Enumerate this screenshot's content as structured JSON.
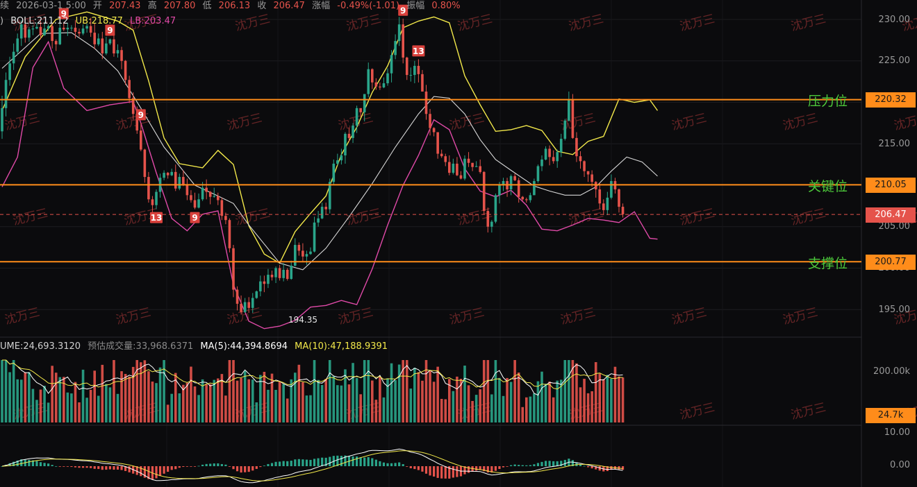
{
  "header": {
    "prefix": "续",
    "datetime": "2026-03-1",
    "datetime_suffix": "5:00",
    "open_label": "开",
    "open": "207.43",
    "high_label": "高",
    "high": "207.80",
    "low_label": "低",
    "low": "206.13",
    "close_label": "收",
    "close": "206.47",
    "change_label": "涨幅",
    "change": "-0.49%(-1.01)",
    "amp_label": "振幅",
    "amp": "0.80%"
  },
  "boll": {
    "paren": ")",
    "mid": "BOLL:211.12",
    "ub": "UB:218.77",
    "lb": "LB:203.47"
  },
  "volume": {
    "volume": "UME:24,693.3120",
    "est": "预估成交量:33,968.6371",
    "ma5": "MA(5):44,394.8694",
    "ma10": "MA(10):47,188.9391"
  },
  "levels": [
    {
      "name": "压力位",
      "value": "220.32",
      "price": 220.32
    },
    {
      "name": "关键位",
      "value": "210.05",
      "price": 210.05
    },
    {
      "name": "支撑位",
      "value": "200.77",
      "price": 200.77
    }
  ],
  "current_price": {
    "value": "206.47",
    "price": 206.47
  },
  "price_ticks": [
    "230.00",
    "225.00",
    "215.00",
    "205.00",
    "200.00",
    "195.00"
  ],
  "volume_ticks": [
    "200.00k"
  ],
  "volume_current": "24.7k",
  "macd_ticks": [
    "10.00",
    "0.00"
  ],
  "low_mark": "194.35",
  "watermark": "沈万三",
  "markers": [
    {
      "text": "9",
      "i": 16,
      "pos": "above"
    },
    {
      "text": "9",
      "i": 28,
      "pos": "above"
    },
    {
      "text": "9",
      "i": 36,
      "pos": "above"
    },
    {
      "text": "13",
      "i": 40,
      "pos": "below"
    },
    {
      "text": "9",
      "i": 50,
      "pos": "below"
    },
    {
      "text": "9",
      "i": 104,
      "pos": "above"
    },
    {
      "text": "13",
      "i": 108,
      "pos": "above"
    }
  ],
  "colors": {
    "up": "#e5534b",
    "down": "#2aa58a",
    "level": "#ff8c1a",
    "level_label": "#4cc83a",
    "mid": "#d8d8d8",
    "ub": "#f2e84a",
    "lb": "#e04aa8",
    "watermark": "#b03a3a"
  },
  "chart_data": {
    "type": "candlestick",
    "title": "",
    "yaxis_range": [
      191.5,
      231.5
    ],
    "candles": [
      [
        216.5,
        219.3,
        220.8,
        215.6
      ],
      [
        219.3,
        222.7,
        223.6,
        218.3
      ],
      [
        222.7,
        224.7,
        225.5,
        222.0
      ],
      [
        224.7,
        226.1,
        227.1,
        223.9
      ],
      [
        226.1,
        227.7,
        228.3,
        225.7
      ],
      [
        227.7,
        229.4,
        229.9,
        226.8
      ],
      [
        229.4,
        227.8,
        230.1,
        227.2
      ],
      [
        227.8,
        228.8,
        229.1,
        227.3
      ],
      [
        228.8,
        228.9,
        229.3,
        228.1
      ],
      [
        228.9,
        229.1,
        229.6,
        228.8
      ],
      [
        229.1,
        228.1,
        229.8,
        227.6
      ],
      [
        228.1,
        228.9,
        229.7,
        228.0
      ],
      [
        228.9,
        229.2,
        229.4,
        228.6
      ],
      [
        229.2,
        227.4,
        229.6,
        226.5
      ],
      [
        227.4,
        227.0,
        227.6,
        226.2
      ],
      [
        227.0,
        229.0,
        230.1,
        226.9
      ],
      [
        229.0,
        228.8,
        229.7,
        228.6
      ],
      [
        228.8,
        229.0,
        229.6,
        228.0
      ],
      [
        229.0,
        229.0,
        229.3,
        228.6
      ],
      [
        229.0,
        228.5,
        229.9,
        227.7
      ],
      [
        228.5,
        228.3,
        228.9,
        227.9
      ],
      [
        228.3,
        228.9,
        229.4,
        228.1
      ],
      [
        228.9,
        229.2,
        229.5,
        228.4
      ],
      [
        229.2,
        228.4,
        230.2,
        227.9
      ],
      [
        228.4,
        227.0,
        229.5,
        226.4
      ],
      [
        227.0,
        227.7,
        228.3,
        226.8
      ],
      [
        227.7,
        225.9,
        228.5,
        225.2
      ],
      [
        225.9,
        227.1,
        227.9,
        225.7
      ],
      [
        227.1,
        227.6,
        227.7,
        226.9
      ],
      [
        227.6,
        225.9,
        228.4,
        225.5
      ],
      [
        225.9,
        226.3,
        227.0,
        225.4
      ],
      [
        226.3,
        225.0,
        226.7,
        224.0
      ],
      [
        225.0,
        222.7,
        225.1,
        222.1
      ],
      [
        222.7,
        220.5,
        223.2,
        219.9
      ],
      [
        220.5,
        218.6,
        221.2,
        217.9
      ],
      [
        218.6,
        216.6,
        219.5,
        216.2
      ],
      [
        216.6,
        214.3,
        217.5,
        214.1
      ],
      [
        214.3,
        211.0,
        214.4,
        210.3
      ],
      [
        211.0,
        208.3,
        211.6,
        207.9
      ],
      [
        208.3,
        207.6,
        208.7,
        206.7
      ],
      [
        207.6,
        209.2,
        209.5,
        207.1
      ],
      [
        209.2,
        210.9,
        211.4,
        208.5
      ],
      [
        210.9,
        211.5,
        211.8,
        210.6
      ],
      [
        211.5,
        211.2,
        211.6,
        210.8
      ],
      [
        211.2,
        211.6,
        212.0,
        211.1
      ],
      [
        211.6,
        209.6,
        212.5,
        209.3
      ],
      [
        209.6,
        211.0,
        211.4,
        209.4
      ],
      [
        211.0,
        210.1,
        211.8,
        209.9
      ],
      [
        210.1,
        208.8,
        210.8,
        208.2
      ],
      [
        208.8,
        208.2,
        209.4,
        207.9
      ],
      [
        208.2,
        207.3,
        209.1,
        207.1
      ],
      [
        207.3,
        208.3,
        209.0,
        207.2
      ],
      [
        208.3,
        209.7,
        210.4,
        208.1
      ],
      [
        209.7,
        209.2,
        210.7,
        208.3
      ],
      [
        209.2,
        208.6,
        209.3,
        207.7
      ],
      [
        208.6,
        208.7,
        209.7,
        208.5
      ],
      [
        208.7,
        208.2,
        209.1,
        207.6
      ],
      [
        208.2,
        206.3,
        208.5,
        205.8
      ],
      [
        206.3,
        205.8,
        206.7,
        205.3
      ],
      [
        205.8,
        202.4,
        206.0,
        201.9
      ],
      [
        202.4,
        197.4,
        202.8,
        196.5
      ],
      [
        197.4,
        195.7,
        197.8,
        194.9
      ],
      [
        195.7,
        194.7,
        196.7,
        194.4
      ],
      [
        194.7,
        195.9,
        196.4,
        194.6
      ],
      [
        195.9,
        195.2,
        196.5,
        194.6
      ],
      [
        195.2,
        196.4,
        197.0,
        194.6
      ],
      [
        196.4,
        197.2,
        197.3,
        196.3
      ],
      [
        197.2,
        198.4,
        199.1,
        196.6
      ],
      [
        198.4,
        198.1,
        199.1,
        197.1
      ],
      [
        198.1,
        199.2,
        199.9,
        197.6
      ],
      [
        199.2,
        198.9,
        199.7,
        198.5
      ],
      [
        198.9,
        200.0,
        200.2,
        198.2
      ],
      [
        200.0,
        198.8,
        200.4,
        198.5
      ],
      [
        198.8,
        199.8,
        200.6,
        198.4
      ],
      [
        199.8,
        198.7,
        200.0,
        198.5
      ],
      [
        198.7,
        200.3,
        200.9,
        198.6
      ],
      [
        200.3,
        202.8,
        203.6,
        200.2
      ],
      [
        202.8,
        202.1,
        203.1,
        201.5
      ],
      [
        202.1,
        201.4,
        203.0,
        200.7
      ],
      [
        201.4,
        201.7,
        202.1,
        200.4
      ],
      [
        201.7,
        202.0,
        202.5,
        201.6
      ],
      [
        202.0,
        205.5,
        206.2,
        201.9
      ],
      [
        205.5,
        206.0,
        206.9,
        205.0
      ],
      [
        206.0,
        207.4,
        207.9,
        205.9
      ],
      [
        207.4,
        207.1,
        207.9,
        206.5
      ],
      [
        207.1,
        210.4,
        210.8,
        206.6
      ],
      [
        210.4,
        212.6,
        213.1,
        210.1
      ],
      [
        212.6,
        213.0,
        213.8,
        212.4
      ],
      [
        213.0,
        213.6,
        214.4,
        212.5
      ],
      [
        213.6,
        216.2,
        216.4,
        212.6
      ],
      [
        216.2,
        215.7,
        216.9,
        215.2
      ],
      [
        215.7,
        217.2,
        217.5,
        215.1
      ],
      [
        217.2,
        219.3,
        219.6,
        216.3
      ],
      [
        219.3,
        218.8,
        219.3,
        218.2
      ],
      [
        218.8,
        221.0,
        221.0,
        217.7
      ],
      [
        221.0,
        224.0,
        224.8,
        220.6
      ],
      [
        224.0,
        222.4,
        224.1,
        221.6
      ],
      [
        222.4,
        221.9,
        222.9,
        221.5
      ],
      [
        221.9,
        221.8,
        222.4,
        221.5
      ],
      [
        221.8,
        222.3,
        223.0,
        221.7
      ],
      [
        222.3,
        223.5,
        224.1,
        222.0
      ],
      [
        223.5,
        225.7,
        226.3,
        222.4
      ],
      [
        225.7,
        227.4,
        228.2,
        225.2
      ],
      [
        227.4,
        229.4,
        230.3,
        226.8
      ],
      [
        229.4,
        225.4,
        230.1,
        224.7
      ],
      [
        225.4,
        223.3,
        225.5,
        222.7
      ],
      [
        223.3,
        223.3,
        224.2,
        222.5
      ],
      [
        223.3,
        224.4,
        225.0,
        222.3
      ],
      [
        224.4,
        223.4,
        225.2,
        222.4
      ],
      [
        223.4,
        221.3,
        223.9,
        221.3
      ],
      [
        221.3,
        218.6,
        222.1,
        217.9
      ],
      [
        218.6,
        216.9,
        219.2,
        216.0
      ],
      [
        216.9,
        216.4,
        217.0,
        215.9
      ],
      [
        216.4,
        213.8,
        216.4,
        213.2
      ],
      [
        213.8,
        213.5,
        214.3,
        213.3
      ],
      [
        213.5,
        212.8,
        213.8,
        212.3
      ],
      [
        212.8,
        211.5,
        213.6,
        211.2
      ],
      [
        211.5,
        212.6,
        213.2,
        211.3
      ],
      [
        212.6,
        211.2,
        213.4,
        211.1
      ],
      [
        211.2,
        210.8,
        211.7,
        210.7
      ],
      [
        210.8,
        213.2,
        213.6,
        210.6
      ],
      [
        213.2,
        212.7,
        214.0,
        212.2
      ],
      [
        212.7,
        212.2,
        212.7,
        211.7
      ],
      [
        212.2,
        212.3,
        212.9,
        212.2
      ],
      [
        212.3,
        211.6,
        213.1,
        211.4
      ],
      [
        211.6,
        206.9,
        211.7,
        206.5
      ],
      [
        206.9,
        205.0,
        207.3,
        204.3
      ],
      [
        205.0,
        205.6,
        205.8,
        204.3
      ],
      [
        205.6,
        208.8,
        209.0,
        205.4
      ],
      [
        208.8,
        210.0,
        210.4,
        207.8
      ],
      [
        210.0,
        210.5,
        210.9,
        209.3
      ],
      [
        210.5,
        209.5,
        210.9,
        208.6
      ],
      [
        209.5,
        211.1,
        211.3,
        208.8
      ],
      [
        211.1,
        210.6,
        211.4,
        210.5
      ],
      [
        210.6,
        208.6,
        210.9,
        207.9
      ],
      [
        208.6,
        208.3,
        208.7,
        208.1
      ],
      [
        208.3,
        208.2,
        208.5,
        207.9
      ],
      [
        208.2,
        208.8,
        209.1,
        207.9
      ],
      [
        208.8,
        210.5,
        210.8,
        208.8
      ],
      [
        210.5,
        212.3,
        212.5,
        210.3
      ],
      [
        212.3,
        213.1,
        213.6,
        211.7
      ],
      [
        213.1,
        214.4,
        214.7,
        213.0
      ],
      [
        214.4,
        213.4,
        214.8,
        212.4
      ],
      [
        213.4,
        212.9,
        214.2,
        212.6
      ],
      [
        212.9,
        214.0,
        214.3,
        212.1
      ],
      [
        214.0,
        215.6,
        216.2,
        213.4
      ],
      [
        215.6,
        217.8,
        218.0,
        215.4
      ],
      [
        217.8,
        220.3,
        221.3,
        217.7
      ],
      [
        220.3,
        215.7,
        221.0,
        215.6
      ],
      [
        215.7,
        213.5,
        216.4,
        212.8
      ],
      [
        213.5,
        212.9,
        214.1,
        212.0
      ],
      [
        212.9,
        211.7,
        213.0,
        211.0
      ],
      [
        211.7,
        211.3,
        211.7,
        210.4
      ],
      [
        211.3,
        210.4,
        211.8,
        209.8
      ],
      [
        210.4,
        209.5,
        210.5,
        208.5
      ],
      [
        209.5,
        207.8,
        210.3,
        207.1
      ],
      [
        207.8,
        207.0,
        208.3,
        206.4
      ],
      [
        207.0,
        208.5,
        209.2,
        206.4
      ],
      [
        208.5,
        210.5,
        211.3,
        208.3
      ],
      [
        210.5,
        209.5,
        210.9,
        209.0
      ],
      [
        209.5,
        207.4,
        209.6,
        206.7
      ],
      [
        207.4,
        206.5,
        207.8,
        206.1
      ]
    ],
    "boll_mid": [
      [
        0,
        224.1
      ],
      [
        10,
        228.3
      ],
      [
        18,
        228.4
      ],
      [
        24,
        226.5
      ],
      [
        30,
        223.8
      ],
      [
        36,
        219.3
      ],
      [
        42,
        214.6
      ],
      [
        50,
        210.0
      ],
      [
        56,
        208.7
      ],
      [
        60,
        207.8
      ],
      [
        64,
        205.2
      ],
      [
        68,
        202.9
      ],
      [
        72,
        200.6
      ],
      [
        78,
        199.8
      ],
      [
        84,
        202.4
      ],
      [
        90,
        206.2
      ],
      [
        96,
        210.2
      ],
      [
        102,
        214.6
      ],
      [
        108,
        218.6
      ],
      [
        112,
        220.7
      ],
      [
        116,
        220.5
      ],
      [
        120,
        218.6
      ],
      [
        124,
        215.5
      ],
      [
        128,
        213.1
      ],
      [
        132,
        211.8
      ],
      [
        138,
        209.9
      ],
      [
        142,
        209.3
      ],
      [
        146,
        208.8
      ],
      [
        150,
        208.8
      ],
      [
        154,
        209.8
      ],
      [
        158,
        211.7
      ],
      [
        162,
        213.4
      ],
      [
        166,
        212.8
      ],
      [
        170,
        211.1
      ]
    ],
    "boll_ub": [
      [
        0,
        219.0
      ],
      [
        6,
        225.5
      ],
      [
        14,
        230.0
      ],
      [
        22,
        230.9
      ],
      [
        30,
        229.8
      ],
      [
        34,
        228.7
      ],
      [
        38,
        222.6
      ],
      [
        42,
        215.7
      ],
      [
        46,
        212.6
      ],
      [
        52,
        212.1
      ],
      [
        56,
        214.2
      ],
      [
        60,
        212.5
      ],
      [
        64,
        205.1
      ],
      [
        68,
        201.7
      ],
      [
        72,
        200.6
      ],
      [
        76,
        204.4
      ],
      [
        80,
        206.6
      ],
      [
        84,
        208.7
      ],
      [
        88,
        213.7
      ],
      [
        92,
        217.0
      ],
      [
        96,
        221.2
      ],
      [
        100,
        224.4
      ],
      [
        104,
        229.0
      ],
      [
        108,
        229.8
      ],
      [
        112,
        230.3
      ],
      [
        116,
        229.6
      ],
      [
        120,
        223.2
      ],
      [
        124,
        219.7
      ],
      [
        128,
        216.5
      ],
      [
        132,
        216.7
      ],
      [
        136,
        217.2
      ],
      [
        140,
        216.6
      ],
      [
        144,
        214.1
      ],
      [
        148,
        213.7
      ],
      [
        152,
        215.3
      ],
      [
        156,
        215.9
      ],
      [
        160,
        220.4
      ],
      [
        164,
        220.0
      ],
      [
        168,
        220.3
      ],
      [
        170,
        219.0
      ]
    ],
    "boll_lb": [
      [
        0,
        209.8
      ],
      [
        4,
        213.4
      ],
      [
        8,
        224.2
      ],
      [
        12,
        227.3
      ],
      [
        16,
        221.7
      ],
      [
        22,
        219.0
      ],
      [
        28,
        219.7
      ],
      [
        34,
        220.1
      ],
      [
        36,
        217.5
      ],
      [
        40,
        211.5
      ],
      [
        44,
        206.0
      ],
      [
        48,
        204.5
      ],
      [
        52,
        206.5
      ],
      [
        56,
        206.9
      ],
      [
        60,
        198.0
      ],
      [
        64,
        193.6
      ],
      [
        68,
        192.7
      ],
      [
        72,
        193.0
      ],
      [
        76,
        193.7
      ],
      [
        80,
        195.3
      ],
      [
        84,
        195.5
      ],
      [
        88,
        196.1
      ],
      [
        92,
        195.6
      ],
      [
        96,
        199.9
      ],
      [
        100,
        205.2
      ],
      [
        104,
        210.0
      ],
      [
        108,
        213.6
      ],
      [
        112,
        217.9
      ],
      [
        116,
        216.7
      ],
      [
        120,
        212.0
      ],
      [
        124,
        209.3
      ],
      [
        128,
        208.6
      ],
      [
        132,
        209.4
      ],
      [
        136,
        207.6
      ],
      [
        140,
        204.7
      ],
      [
        144,
        204.5
      ],
      [
        148,
        205.2
      ],
      [
        152,
        206.0
      ],
      [
        156,
        205.8
      ],
      [
        160,
        205.5
      ],
      [
        164,
        206.8
      ],
      [
        168,
        203.6
      ],
      [
        170,
        203.5
      ]
    ]
  }
}
